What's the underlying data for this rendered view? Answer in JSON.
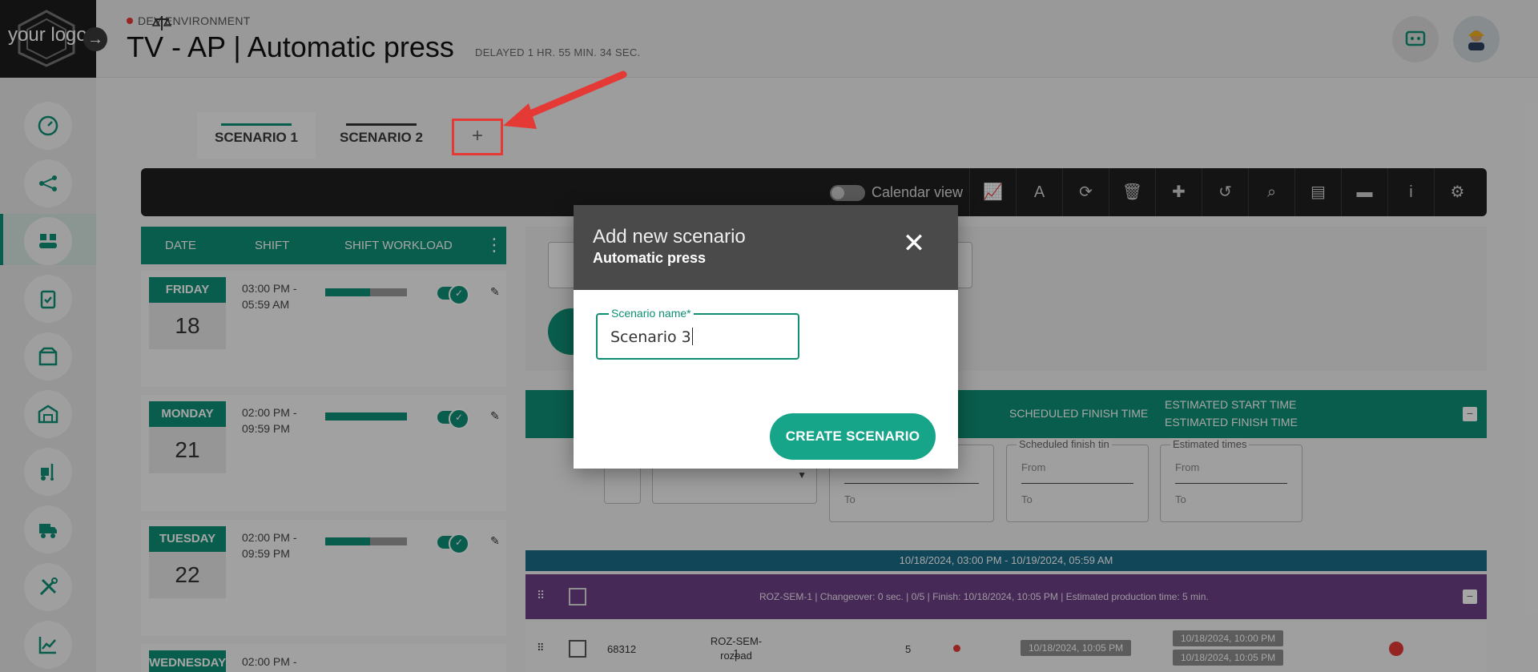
{
  "header": {
    "logo_text": "your logo",
    "environment": "DEV ENVIRONMENT",
    "title": "TV - AP | Automatic press",
    "delayed": "DELAYED 1 HR. 55 MIN. 34 SEC."
  },
  "tabs": [
    {
      "label": "SCENARIO 1",
      "bar_color": "#0e8f75"
    },
    {
      "label": "SCENARIO 2",
      "bar_color": "#333333"
    }
  ],
  "add_tab_label": "+",
  "toolbar": {
    "calendar_label": "Calendar view"
  },
  "left_table": {
    "headers": [
      "DATE",
      "SHIFT",
      "SHIFT WORKLOAD"
    ],
    "days": [
      {
        "name": "FRIDAY",
        "num": "18",
        "time1": "03:00 PM -",
        "time2": "05:59 AM",
        "workload": 0.55
      },
      {
        "name": "MONDAY",
        "num": "21",
        "time1": "02:00 PM -",
        "time2": "09:59 PM",
        "workload": 1.0
      },
      {
        "name": "TUESDAY",
        "num": "22",
        "time1": "02:00 PM -",
        "time2": "09:59 PM",
        "workload": 0.55
      },
      {
        "name": "WEDNESDAY",
        "num": "",
        "time1": "02:00 PM -",
        "time2": "",
        "workload": 0
      }
    ]
  },
  "right": {
    "col_scheduled_finish": "SCHEDULED FINISH TIME",
    "col_est_start": "ESTIMATED START TIME",
    "col_est_finish": "ESTIMATED FINISH TIME",
    "filter_sched_finish": "Scheduled finish tin",
    "filter_est_times": "Estimated times",
    "from": "From",
    "to": "To",
    "period": "10/18/2024, 03:00 PM - 10/19/2024, 05:59 AM",
    "group_summary": "ROZ-SEM-1 | Changeover: 0 sec. | 0/5 | Finish: 10/18/2024, 10:05 PM | Estimated production time: 5 min.",
    "row": {
      "id": "68312",
      "code": "ROZ-SEM-1",
      "name": "rozpad",
      "qty": "5",
      "sched_finish": "10/18/2024, 10:05 PM",
      "est_start": "10/18/2024, 10:00 PM",
      "est_finish": "10/18/2024, 10:05 PM"
    }
  },
  "modal": {
    "title": "Add new scenario",
    "subtitle": "Automatic press",
    "close": "✕",
    "field_label": "Scenario name*",
    "field_value": "Scenario 3",
    "create_label": "CREATE SCENARIO"
  }
}
